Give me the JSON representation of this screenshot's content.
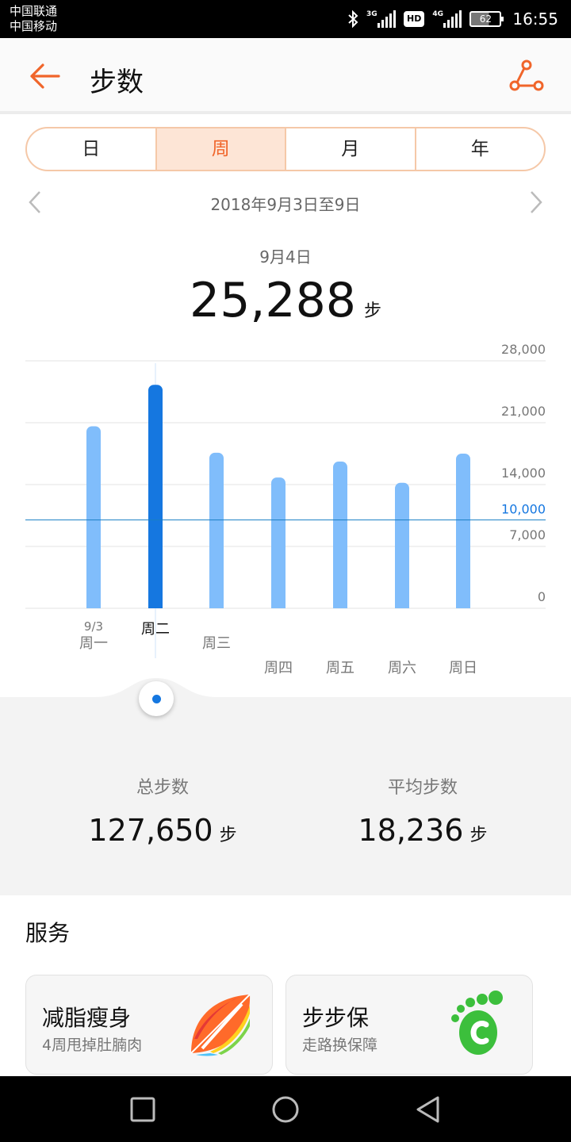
{
  "status": {
    "carrier1": "中国联通",
    "carrier2": "中国移动",
    "net1": "3G",
    "hd": "HD",
    "net2": "4G",
    "battery": "62",
    "time": "16:55"
  },
  "header": {
    "title": "步数"
  },
  "tabs": [
    {
      "label": "日"
    },
    {
      "label": "周"
    },
    {
      "label": "月"
    },
    {
      "label": "年"
    }
  ],
  "active_tab": 1,
  "range": "2018年9月3日至9日",
  "selected": {
    "date": "9月4日",
    "value": "25,288",
    "unit": "步"
  },
  "chart_data": {
    "type": "bar",
    "categories": [
      "周一",
      "周二",
      "周三",
      "周四",
      "周五",
      "周六",
      "周日"
    ],
    "category_sublabels": [
      "9/3",
      "",
      "",
      "",
      "",
      "",
      ""
    ],
    "values": [
      20600,
      25288,
      17600,
      14800,
      16600,
      14200,
      17500
    ],
    "selected_index": 1,
    "yticks": [
      "28,000",
      "21,000",
      "14,000",
      "7,000",
      "0"
    ],
    "ytick_values": [
      28000,
      21000,
      14000,
      7000,
      0
    ],
    "ylim": [
      0,
      28000
    ],
    "goal_line": 10000,
    "goal_label": "10,000",
    "colors": {
      "bar": "#80bdfb",
      "selected": "#1577e0",
      "goal": "#1a7fc4"
    }
  },
  "summary": {
    "total_label": "总步数",
    "total_value": "127,650",
    "avg_label": "平均步数",
    "avg_value": "18,236",
    "unit": "步"
  },
  "services": {
    "title": "服务",
    "cards": [
      {
        "title": "减脂瘦身",
        "subtitle": "4周甩掉肚腩肉",
        "icon": "rainbow-leaf-icon"
      },
      {
        "title": "步步保",
        "subtitle": "走路换保障",
        "icon": "green-footprint-icon"
      }
    ]
  },
  "colors": {
    "accent": "#f0652a",
    "blue": "#1577e0"
  }
}
